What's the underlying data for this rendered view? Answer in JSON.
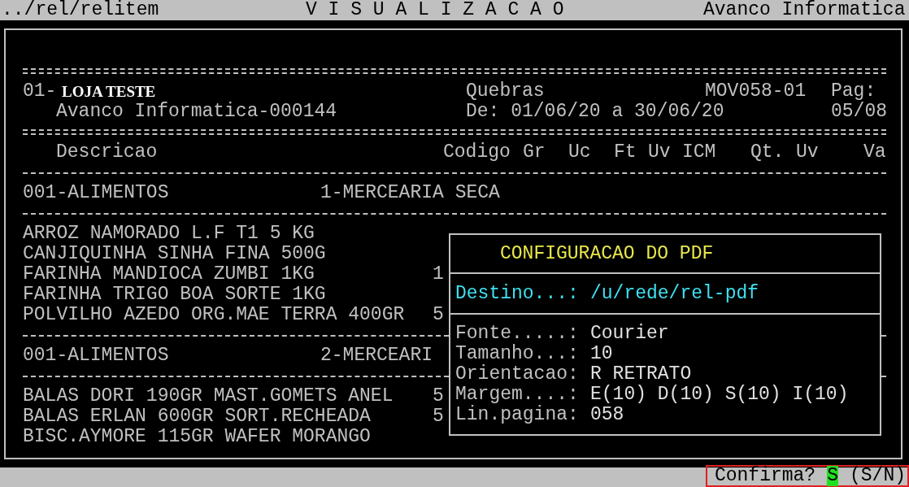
{
  "top_bar": {
    "path": "../rel/relitem",
    "title": "V I S U A L I Z A C A O",
    "company": "Avanco Informatica"
  },
  "report": {
    "store_code": "01-",
    "store_name": "LOJA TESTE",
    "report_title": "Quebras",
    "report_code": "MOV058-01",
    "page_label": "Pag:",
    "company_line": "Avanco Informatica-000144",
    "period": "De: 01/06/20 a 30/06/20",
    "page": "05/08",
    "columns": [
      "Descricao",
      "Codigo",
      "Gr",
      "Uc",
      "Ft",
      "Uv",
      "ICM",
      "Qt.",
      "Uv",
      "Va"
    ],
    "groups": [
      {
        "department": "001-ALIMENTOS",
        "section": "1-MERCEARIA SECA",
        "items": [
          {
            "description": "ARROZ NAMORADO L.F T1 5 KG"
          },
          {
            "description": "CANJIQUINHA SINHA FINA 500G"
          },
          {
            "description": "FARINHA MANDIOCA ZUMBI 1KG",
            "column_2": "1"
          },
          {
            "description": "FARINHA TRIGO BOA SORTE 1KG"
          },
          {
            "description": "POLVILHO AZEDO ORG.MAE TERRA 400GR",
            "column_2": "5"
          }
        ]
      },
      {
        "department": "001-ALIMENTOS",
        "section": "2-MERCEARI",
        "items": [
          {
            "description": "BALAS DORI 190GR MAST.GOMETS ANEL",
            "column_2": "5"
          },
          {
            "description": "BALAS ERLAN 600GR SORT.RECHEADA",
            "column_2": "5"
          },
          {
            "description": "BISC.AYMORE 115GR WAFER MORANGO"
          }
        ]
      }
    ]
  },
  "dialog": {
    "title": "CONFIGURACAO DO PDF",
    "destination": {
      "label": "Destino...:",
      "value": "/u/rede/rel-pdf"
    },
    "fields": [
      {
        "label": "Fonte.....:",
        "value": "Courier"
      },
      {
        "label": "Tamanho...:",
        "value": "10"
      },
      {
        "label": "Orientacao:",
        "value": "R RETRATO"
      },
      {
        "label": "Margem....:",
        "value": "E(10) D(10) S(10) I(10)"
      },
      {
        "label": "Lin.pagina:",
        "value": "058"
      }
    ]
  },
  "prompt": {
    "question": "Confirma?",
    "answer": "S",
    "options": "(S/N)"
  }
}
